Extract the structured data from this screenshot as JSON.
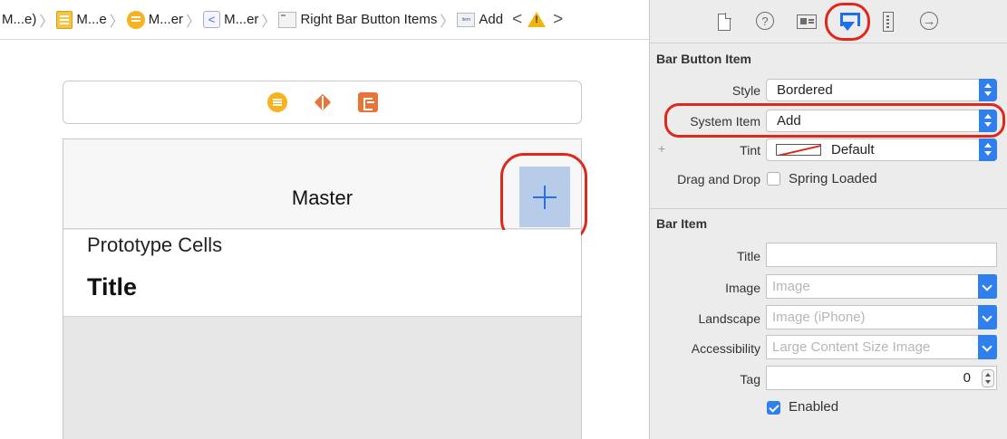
{
  "jumpbar": {
    "crumbs": [
      "M...e)",
      "M...e",
      "M...er",
      "M...er",
      "Right Bar Button Items",
      "Add"
    ],
    "prev_label": "<",
    "next_label": ">",
    "warning_glyph": "!"
  },
  "scene": {
    "nav_title": "Master",
    "prototype_label": "Prototype Cells",
    "cell_title": "Title"
  },
  "inspector": {
    "tabs": [
      "file-inspector",
      "quick-help",
      "identity-inspector",
      "attributes-inspector",
      "size-inspector",
      "connections-inspector"
    ],
    "help_glyph": "?",
    "conn_glyph": "→",
    "bar_button_item": {
      "header": "Bar Button Item",
      "style_label": "Style",
      "style_value": "Bordered",
      "system_item_label": "System Item",
      "system_item_value": "Add",
      "tint_label": "Tint",
      "tint_value": "Default",
      "drag_drop_label": "Drag and Drop",
      "spring_loaded_label": "Spring Loaded",
      "spring_loaded_checked": false
    },
    "bar_item": {
      "header": "Bar Item",
      "title_label": "Title",
      "title_value": "",
      "image_label": "Image",
      "image_placeholder": "Image",
      "landscape_label": "Landscape",
      "landscape_placeholder": "Image (iPhone)",
      "accessibility_label": "Accessibility",
      "accessibility_placeholder": "Large Content Size Image",
      "tag_label": "Tag",
      "tag_value": "0",
      "enabled_label": "Enabled",
      "enabled_checked": true
    }
  },
  "colors": {
    "accent": "#2f80ed",
    "highlight_ring": "#e0271b",
    "selected_item": "#b7cce8"
  }
}
